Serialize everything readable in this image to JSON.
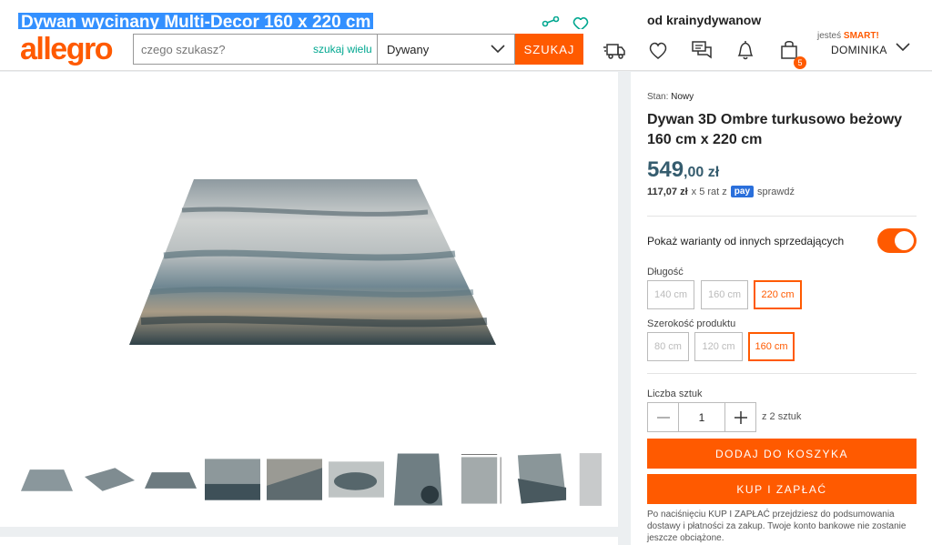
{
  "behind_header": {
    "title": "Dywan wycinany Multi-Decor 160 x 220 cm",
    "seller": "od krainydywanow"
  },
  "header": {
    "logo": "allegro",
    "search_placeholder": "czego szukasz?",
    "search_many": "szukaj wielu",
    "category": "Dywany",
    "search_button": "SZUKAJ",
    "cart_count": "5",
    "smart_prefix": "jesteś",
    "smart_label": "SMART!",
    "user": "DOMINIKA",
    "icons": [
      "truck-icon",
      "heart-icon",
      "chat-icon",
      "bell-icon",
      "cart-icon"
    ]
  },
  "gallery": {
    "thumb_count": 10
  },
  "product": {
    "condition_label": "Stan:",
    "condition_value": "Nowy",
    "title": "Dywan 3D Ombre turkusowo beżowy 160 cm x 220 cm",
    "price_main": "549",
    "price_rest": ",00 zł",
    "installment_amount": "117,07 zł",
    "installment_text": "x 5 rat z",
    "pay_logo": "pay",
    "installment_check": "sprawdź",
    "variants_label": "Pokaż warianty od innych sprzedających",
    "variants_toggle_on": true,
    "length_label": "Długość",
    "length_options": [
      "140 cm",
      "160 cm",
      "220 cm"
    ],
    "length_selected": "220 cm",
    "width_label": "Szerokość produktu",
    "width_options": [
      "80 cm",
      "120 cm",
      "160 cm"
    ],
    "width_selected": "160 cm",
    "qty_label": "Liczba sztuk",
    "qty_value": "1",
    "qty_of": "z 2 sztuk",
    "add_to_cart": "DODAJ DO KOSZYKA",
    "buy_now": "KUP I ZAPŁAĆ",
    "note": "Po naciśnięciu KUP I ZAPŁAĆ przejdziesz do podsumowania dostawy i płatności za zakup. Twoje konto bankowe nie zostanie jeszcze obciążone."
  },
  "colors": {
    "accent": "#ff5a00",
    "price": "#355c6e",
    "teal_link": "#00a790"
  }
}
